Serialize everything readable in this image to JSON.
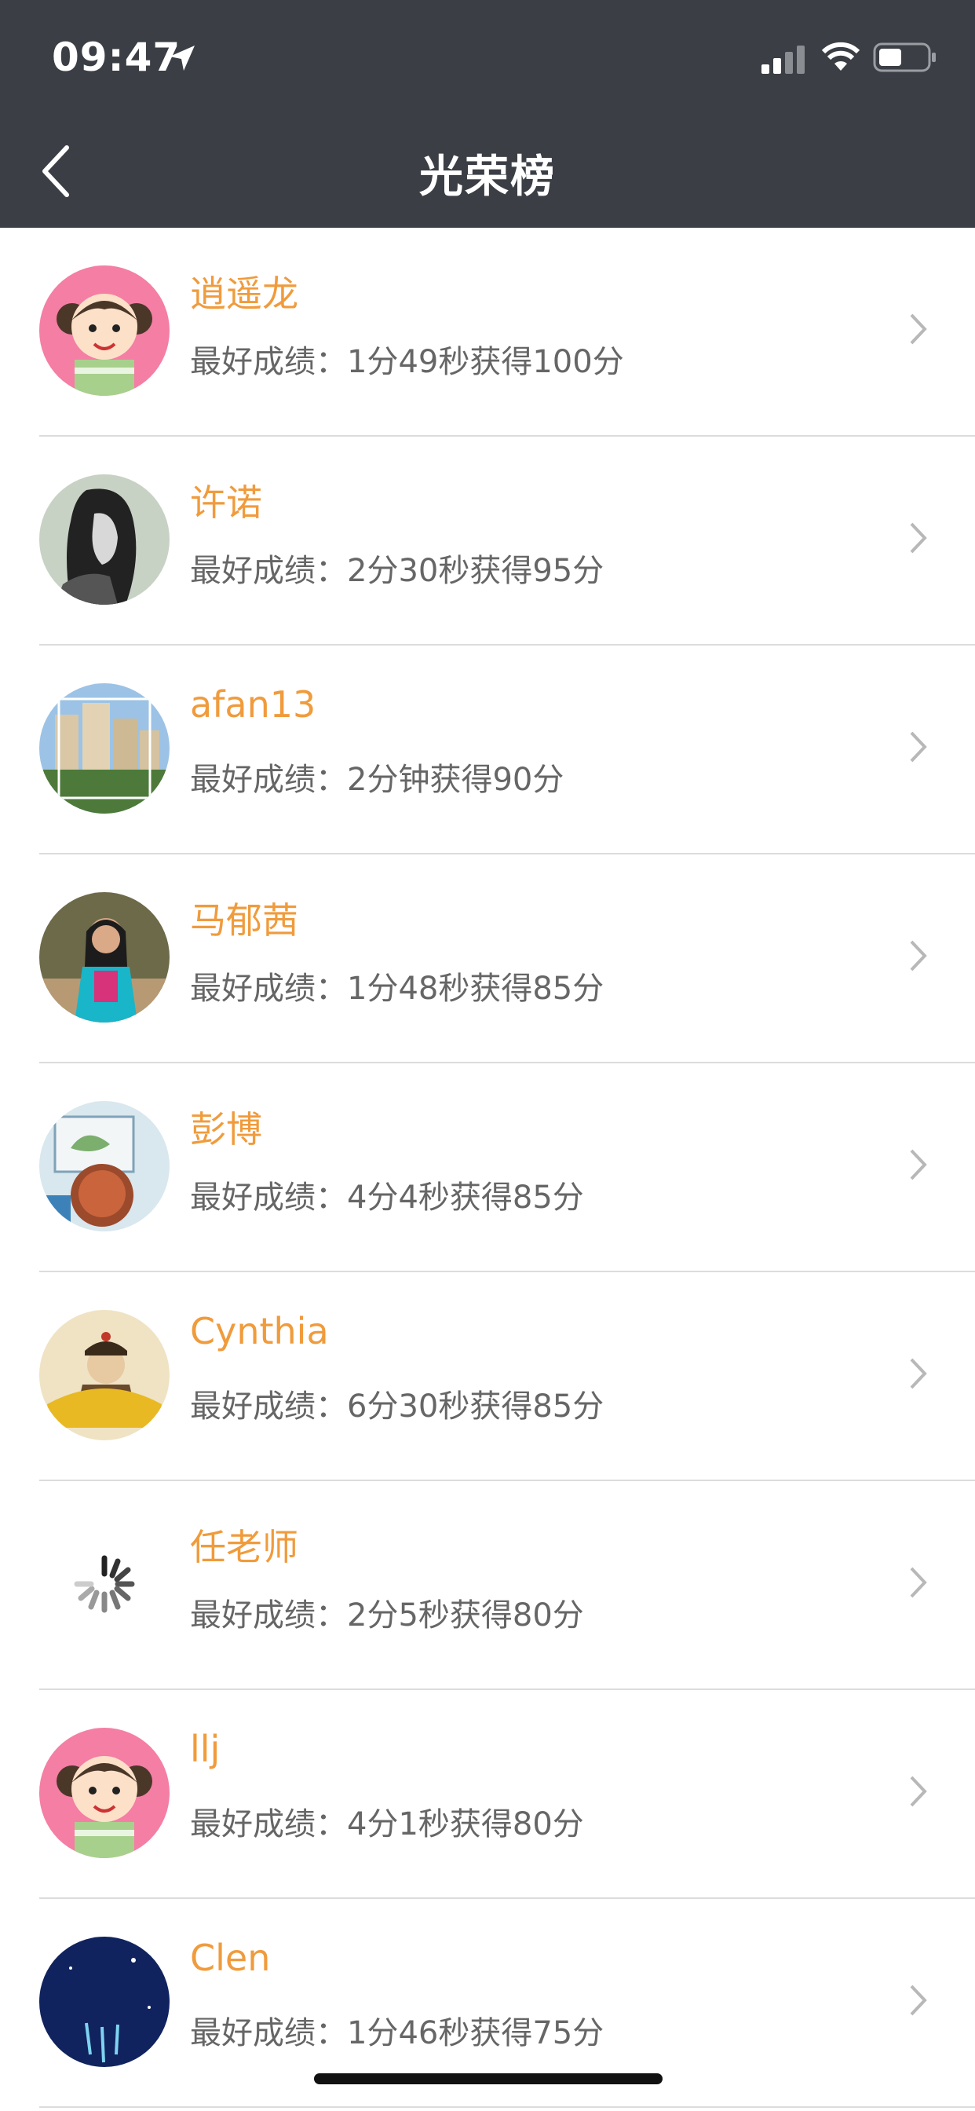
{
  "status_bar": {
    "time": "09:47"
  },
  "nav": {
    "title": "光荣榜",
    "back_icon": "chevron-left-icon"
  },
  "colors": {
    "nav_bg": "#3b3f45",
    "name_color": "#f09b3c",
    "score_color": "#666666"
  },
  "entries": [
    {
      "name": "逍遥龙",
      "score": "最好成绩：1分49秒获得100分",
      "avatar": "cartoon-girl"
    },
    {
      "name": "许诺",
      "score": "最好成绩：2分30秒获得95分",
      "avatar": "sketch-portrait"
    },
    {
      "name": "afan13",
      "score": "最好成绩：2分钟获得90分",
      "avatar": "buildings-photo"
    },
    {
      "name": "马郁茜",
      "score": "最好成绩：1分48秒获得85分",
      "avatar": "girl-photo"
    },
    {
      "name": "彭博",
      "score": "最好成绩：4分4秒获得85分",
      "avatar": "child-illustration"
    },
    {
      "name": "Cynthia",
      "score": "最好成绩：6分30秒获得85分",
      "avatar": "emperor-portrait"
    },
    {
      "name": "任老师",
      "score": "最好成绩：2分5秒获得80分",
      "avatar": "loading-spinner"
    },
    {
      "name": "llj",
      "score": "最好成绩：4分1秒获得80分",
      "avatar": "cartoon-girl"
    },
    {
      "name": "Clen",
      "score": "最好成绩：1分46秒获得75分",
      "avatar": "moon-night"
    }
  ]
}
